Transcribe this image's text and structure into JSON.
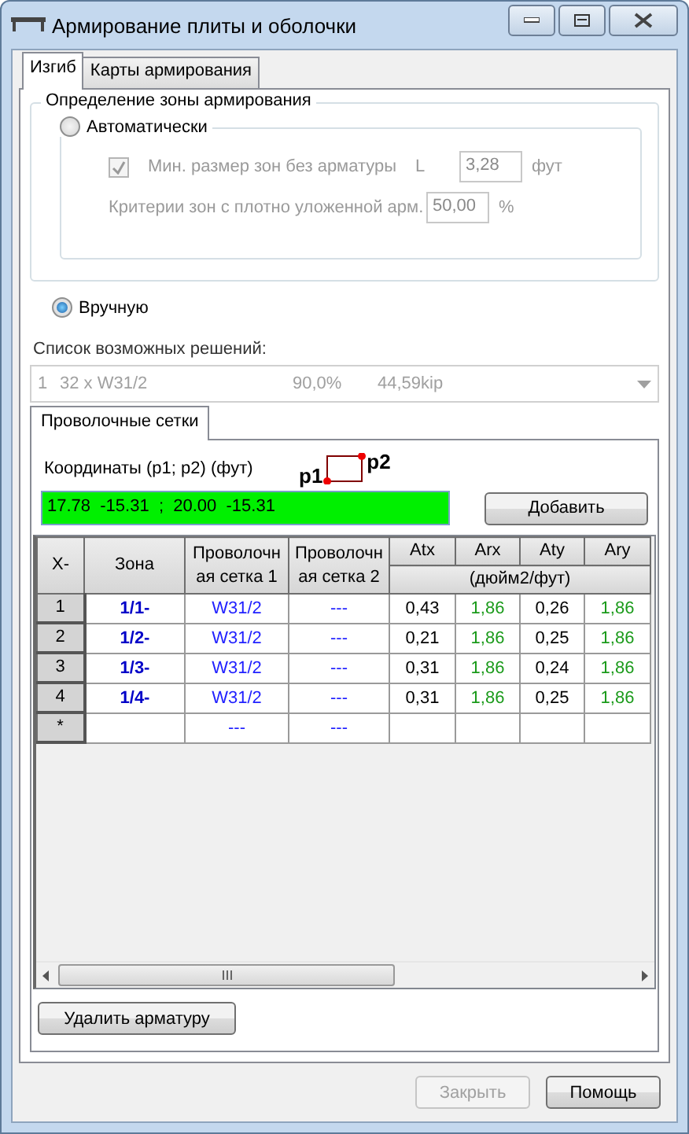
{
  "window": {
    "title": "Армирование плиты и оболочки"
  },
  "tabs": [
    {
      "label": "Изгиб",
      "selected": true
    },
    {
      "label": "Карты армирования",
      "selected": false
    }
  ],
  "zone_group": {
    "title": "Определение зоны армирования",
    "auto": {
      "label": "Автоматически",
      "selected": false
    },
    "min_size": {
      "label": "Мин. размер зон без арматуры",
      "checked": true,
      "disabled": true,
      "prefix": "L",
      "value": "3,28",
      "unit": "фут"
    },
    "dense": {
      "label": "Критерии зон с плотно уложенной арм.",
      "value": "50,00",
      "unit": "%"
    },
    "manual": {
      "label": "Вручную",
      "selected": true
    }
  },
  "solutions": {
    "label": "Список возможных решений:",
    "disabled": true,
    "parts": [
      "1",
      "32 x W31/2",
      "90,0%",
      "44,59kip"
    ]
  },
  "inner_tabs": [
    {
      "label": "Проволочные сетки",
      "selected": true
    }
  ],
  "coords": {
    "label": "Координаты (p1; p2) (фут)",
    "p1": "p1",
    "p2": "p2",
    "value": "17.78  -15.31  ;  20.00  -15.31",
    "add_button": "Добавить"
  },
  "table": {
    "corner": "X-",
    "columns": [
      {
        "label": "Зона",
        "kind": "zone"
      },
      {
        "label": "Проволочная сетка 1",
        "kind": "mesh"
      },
      {
        "label": "Проволочная сетка 2",
        "kind": "mesh"
      },
      {
        "label": "Atx",
        "kind": "value"
      },
      {
        "label": "Arx",
        "kind": "result"
      },
      {
        "label": "Aty",
        "kind": "value"
      },
      {
        "label": "Ary",
        "kind": "result"
      }
    ],
    "units": "(дюйм2/фут)",
    "rows": [
      {
        "header": "1",
        "cells": [
          "1/1-",
          "W31/2",
          "---",
          "0,43",
          "1,86",
          "0,26",
          "1,86"
        ]
      },
      {
        "header": "2",
        "cells": [
          "1/2-",
          "W31/2",
          "---",
          "0,21",
          "1,86",
          "0,25",
          "1,86"
        ]
      },
      {
        "header": "3",
        "cells": [
          "1/3-",
          "W31/2",
          "---",
          "0,31",
          "1,86",
          "0,24",
          "1,86"
        ]
      },
      {
        "header": "4",
        "cells": [
          "1/4-",
          "W31/2",
          "---",
          "0,31",
          "1,86",
          "0,25",
          "1,86"
        ]
      },
      {
        "header": "*",
        "cells": [
          "",
          "---",
          "---",
          "",
          "",
          "",
          ""
        ]
      }
    ]
  },
  "delete_button": "Удалить арматуру",
  "footer_buttons": [
    {
      "label": "Закрыть",
      "disabled": true
    },
    {
      "label": "Помощь",
      "disabled": false
    }
  ]
}
